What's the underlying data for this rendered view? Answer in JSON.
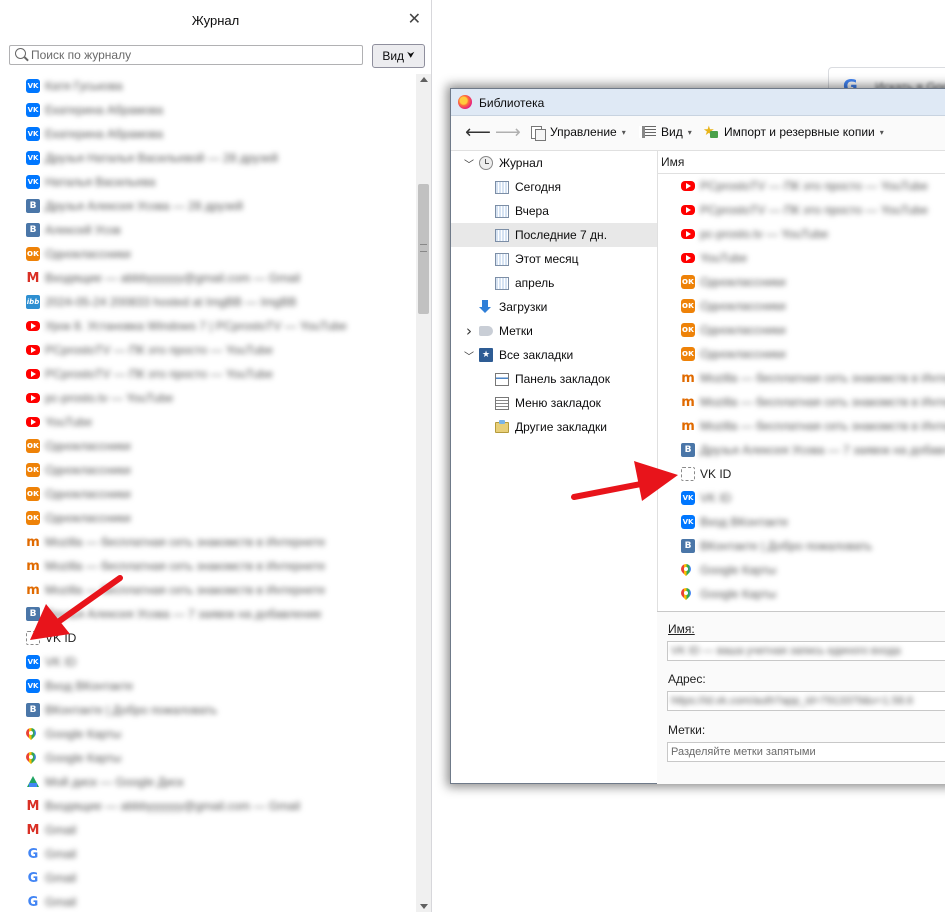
{
  "sidebar": {
    "title": "Журнал",
    "close_glyph": "✕",
    "search_placeholder": "Поиск по журналу",
    "view_button": "Вид",
    "items": [
      {
        "icon": "vk-icon",
        "title": "Катя Гуськова"
      },
      {
        "icon": "vk-icon",
        "title": "Екатерина Абрамова"
      },
      {
        "icon": "vk-icon",
        "title": "Екатерина Абрамова"
      },
      {
        "icon": "vk-icon",
        "title": "Друзья Наталья Васильевой — 28 друзей"
      },
      {
        "icon": "vk-icon",
        "title": "Наталья Васильева"
      },
      {
        "icon": "vkontakte-b-icon",
        "title": "Друзья Алексея Усова — 28 друзей"
      },
      {
        "icon": "vkontakte-b-icon",
        "title": "Алексей Усов"
      },
      {
        "icon": "odnoklassniki-icon",
        "title": "Одноклассники"
      },
      {
        "icon": "gmail-icon",
        "title": "Входящие — abbbyyyyyy@gmail.com — Gmail"
      },
      {
        "icon": "imgbb-icon",
        "title": "2024-05-24 200833 hosted at ImgBB — ImgBB"
      },
      {
        "icon": "youtube-icon",
        "title": "Урок 8. Установка Windows 7 | PCprostoTV — YouTube"
      },
      {
        "icon": "youtube-icon",
        "title": "PCprostoTV — ПК это просто — YouTube"
      },
      {
        "icon": "youtube-icon",
        "title": "PCprostoTV — ПК это просто — YouTube"
      },
      {
        "icon": "youtube-icon",
        "title": "pc-prosto.tv — YouTube"
      },
      {
        "icon": "youtube-icon",
        "title": "YouTube"
      },
      {
        "icon": "odnoklassniki-icon",
        "title": "Одноклассники"
      },
      {
        "icon": "odnoklassniki-icon",
        "title": "Одноклассники"
      },
      {
        "icon": "odnoklassniki-icon",
        "title": "Одноклассники"
      },
      {
        "icon": "odnoklassniki-icon",
        "title": "Одноклассники"
      },
      {
        "icon": "mozilla-icon",
        "title": "Mozilla — бесплатная сеть знакомств в Интернете"
      },
      {
        "icon": "mozilla-icon",
        "title": "Mozilla — бесплатная сеть знакомств в Интернете"
      },
      {
        "icon": "mozilla-icon",
        "title": "Mozilla — бесплатная сеть знакомств в Интернете"
      },
      {
        "icon": "vkontakte-b-icon",
        "title": "Друзья Алексея Усова — 7 заявок на добавление"
      },
      {
        "icon": "vk-id-icon",
        "title": "VK ID",
        "clear": true
      },
      {
        "icon": "vk-icon",
        "title": "VK ID"
      },
      {
        "icon": "vk-icon",
        "title": "Вход ВКонтакте"
      },
      {
        "icon": "vkontakte-b-icon",
        "title": "ВКонтакте | Добро пожаловать"
      },
      {
        "icon": "google-maps-icon",
        "title": "Google Карты"
      },
      {
        "icon": "google-maps-icon",
        "title": "Google Карты"
      },
      {
        "icon": "google-drive-icon",
        "title": "Мой диск — Google Диск"
      },
      {
        "icon": "gmail-icon",
        "title": "Входящие — abbbyyyyyy@gmail.com — Gmail"
      },
      {
        "icon": "gmail-icon",
        "title": "Gmail"
      },
      {
        "icon": "google-icon",
        "title": "Gmail"
      },
      {
        "icon": "google-icon",
        "title": "Gmail"
      },
      {
        "icon": "google-icon",
        "title": "Gmail"
      }
    ]
  },
  "background_page": {
    "google_button_text": "Искать в Google"
  },
  "library": {
    "window_title": "Библиотека",
    "toolbar": {
      "manage": "Управление",
      "view": "Вид",
      "import": "Импорт и резервные копии"
    },
    "tree": [
      {
        "label": "Журнал",
        "icon": "clock-icon",
        "depth": 0,
        "twisty": "down"
      },
      {
        "label": "Сегодня",
        "icon": "calendar-icon",
        "depth": 1
      },
      {
        "label": "Вчера",
        "icon": "calendar-icon",
        "depth": 1
      },
      {
        "label": "Последние 7 дн.",
        "icon": "calendar-icon",
        "depth": 1,
        "selected": true
      },
      {
        "label": "Этот месяц",
        "icon": "calendar-icon",
        "depth": 1
      },
      {
        "label": "апрель",
        "icon": "calendar-icon",
        "depth": 1
      },
      {
        "label": "Загрузки",
        "icon": "download-icon",
        "depth": 0
      },
      {
        "label": "Метки",
        "icon": "tag-icon",
        "depth": 0,
        "twisty": "right"
      },
      {
        "label": "Все закладки",
        "icon": "bookmarks-star-icon",
        "depth": 0,
        "twisty": "down"
      },
      {
        "label": "Панель закладок",
        "icon": "bookmarks-toolbar-icon",
        "depth": 1
      },
      {
        "label": "Меню закладок",
        "icon": "bookmarks-menu-icon",
        "depth": 1
      },
      {
        "label": "Другие закладки",
        "icon": "folder-icon",
        "depth": 1
      }
    ],
    "column_header": "Имя",
    "items": [
      {
        "icon": "youtube-icon",
        "title": "PCprostoTV — ПК это просто — YouTube"
      },
      {
        "icon": "youtube-icon",
        "title": "PCprostoTV — ПК это просто — YouTube"
      },
      {
        "icon": "youtube-icon",
        "title": "pc-prosto.tv — YouTube"
      },
      {
        "icon": "youtube-icon",
        "title": "YouTube"
      },
      {
        "icon": "odnoklassniki-icon",
        "title": "Одноклассники"
      },
      {
        "icon": "odnoklassniki-icon",
        "title": "Одноклассники"
      },
      {
        "icon": "odnoklassniki-icon",
        "title": "Одноклассники"
      },
      {
        "icon": "odnoklassniki-icon",
        "title": "Одноклассники"
      },
      {
        "icon": "mozilla-icon",
        "title": "Mozilla — бесплатная сеть знакомств в Интернете"
      },
      {
        "icon": "mozilla-icon",
        "title": "Mozilla — бесплатная сеть знакомств в Интернете"
      },
      {
        "icon": "mozilla-icon",
        "title": "Mozilla — бесплатная сеть знакомств в Интернете"
      },
      {
        "icon": "vkontakte-b-icon",
        "title": "Друзья Алексея Усова — 7 заявок на добавление"
      },
      {
        "icon": "vk-id-icon",
        "title": "VK ID",
        "clear": true
      },
      {
        "icon": "vk-icon",
        "title": "VK ID"
      },
      {
        "icon": "vk-icon",
        "title": "Вход ВКонтакте"
      },
      {
        "icon": "vkontakte-b-icon",
        "title": "ВКонтакте | Добро пожаловать"
      },
      {
        "icon": "google-maps-icon",
        "title": "Google Карты"
      },
      {
        "icon": "google-maps-icon",
        "title": "Google Карты"
      }
    ],
    "details": {
      "name_label": "Имя:",
      "name_value": "VK ID — ваша учетная запись единого входа",
      "address_label": "Адрес:",
      "address_value": "https://id.vk.com/auth?app_id=7913379&v=1.58.6",
      "tags_label": "Метки:",
      "tags_placeholder": "Разделяйте метки запятыми"
    }
  },
  "colors": {
    "annotation_arrow": "#e8141b",
    "selection": "#e8e8e8",
    "titlebar": "#dfe9f5"
  }
}
